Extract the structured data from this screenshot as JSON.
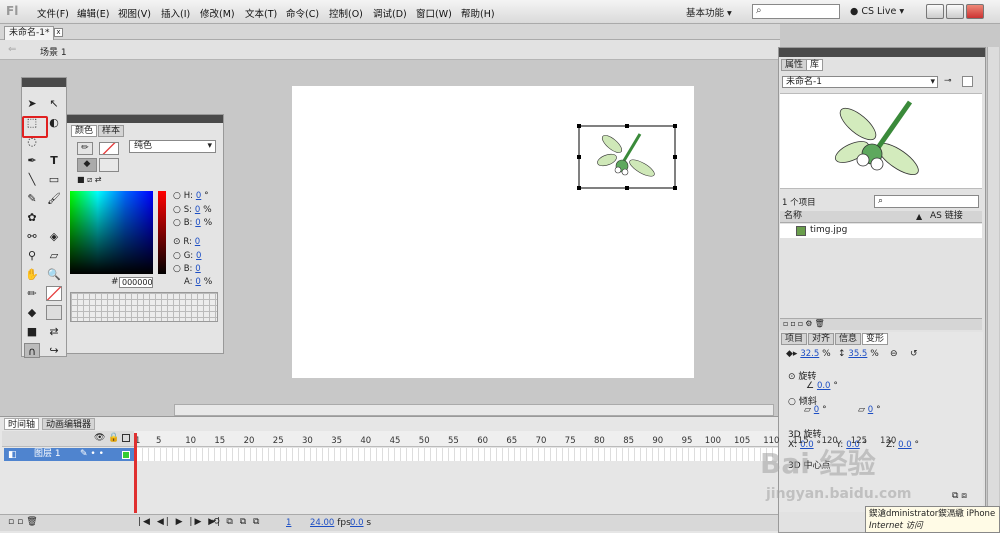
{
  "app": {
    "logo": "Fl"
  },
  "menu": [
    "文件(F)",
    "编辑(E)",
    "视图(V)",
    "插入(I)",
    "修改(M)",
    "文本(T)",
    "命令(C)",
    "控制(O)",
    "调试(D)",
    "窗口(W)",
    "帮助(H)"
  ],
  "header": {
    "workspace": "基本功能",
    "search_icon": "⌕",
    "cslive": "CS Live"
  },
  "doc": {
    "tab": "未命名-1*",
    "close": "x",
    "scene": "场景 1"
  },
  "color_panel": {
    "tabs": [
      "颜色",
      "样本"
    ],
    "fill_type": "纯色",
    "hsb": [
      {
        "label": "H:",
        "value": "0",
        "unit": "°"
      },
      {
        "label": "S:",
        "value": "0",
        "unit": "%"
      },
      {
        "label": "B:",
        "value": "0",
        "unit": "%"
      }
    ],
    "rgb": [
      {
        "label": "R:",
        "value": "0"
      },
      {
        "label": "G:",
        "value": "0"
      },
      {
        "label": "B:",
        "value": "0"
      }
    ],
    "hex_label": "#",
    "hex": "000000",
    "alpha": {
      "label": "A:",
      "value": "0",
      "unit": "%"
    }
  },
  "library": {
    "tabs": [
      "属性",
      "库"
    ],
    "document": "未命名-1",
    "count": "1 个项目",
    "col_name": "名称",
    "col_link": "AS 链接",
    "items": [
      "timg.jpg"
    ]
  },
  "transform": {
    "tabs": [
      "项目",
      "对齐",
      "信息",
      "变形"
    ],
    "width": "32.5",
    "height": "35.5",
    "percent": "%",
    "rotate_label": "旋转",
    "rotate_value": "0.0",
    "skew_label": "倾斜",
    "skew_h": "0",
    "skew_v": "0",
    "deg": "°",
    "rot3d_label": "3D 旋转",
    "x_label": "X:",
    "x_value": "0.0",
    "y_label": "Y:",
    "y_value": "0.0",
    "z_label": "Z:",
    "z_value": "0.0",
    "center_label": "3D 中心点"
  },
  "timeline": {
    "tabs": [
      "时间轴",
      "动画编辑器"
    ],
    "layer": "图层 1",
    "ticks": [
      "1",
      "5",
      "10",
      "15",
      "20",
      "25",
      "30",
      "35",
      "40",
      "45",
      "50",
      "55",
      "60",
      "65",
      "70",
      "75",
      "80",
      "85",
      "90",
      "95",
      "100",
      "105",
      "110",
      "115",
      "120",
      "125",
      "130"
    ],
    "frame": "1",
    "fps": "24.00",
    "fps_unit": "fps",
    "time": "0.0",
    "time_unit": "s"
  },
  "tooltip": {
    "line1": "鍥滄dministrator鍥滆繖 iPhone",
    "line2": "Internet 访问"
  },
  "watermark": {
    "brand": "Bai 经验",
    "url": "jingyan.baidu.com"
  }
}
